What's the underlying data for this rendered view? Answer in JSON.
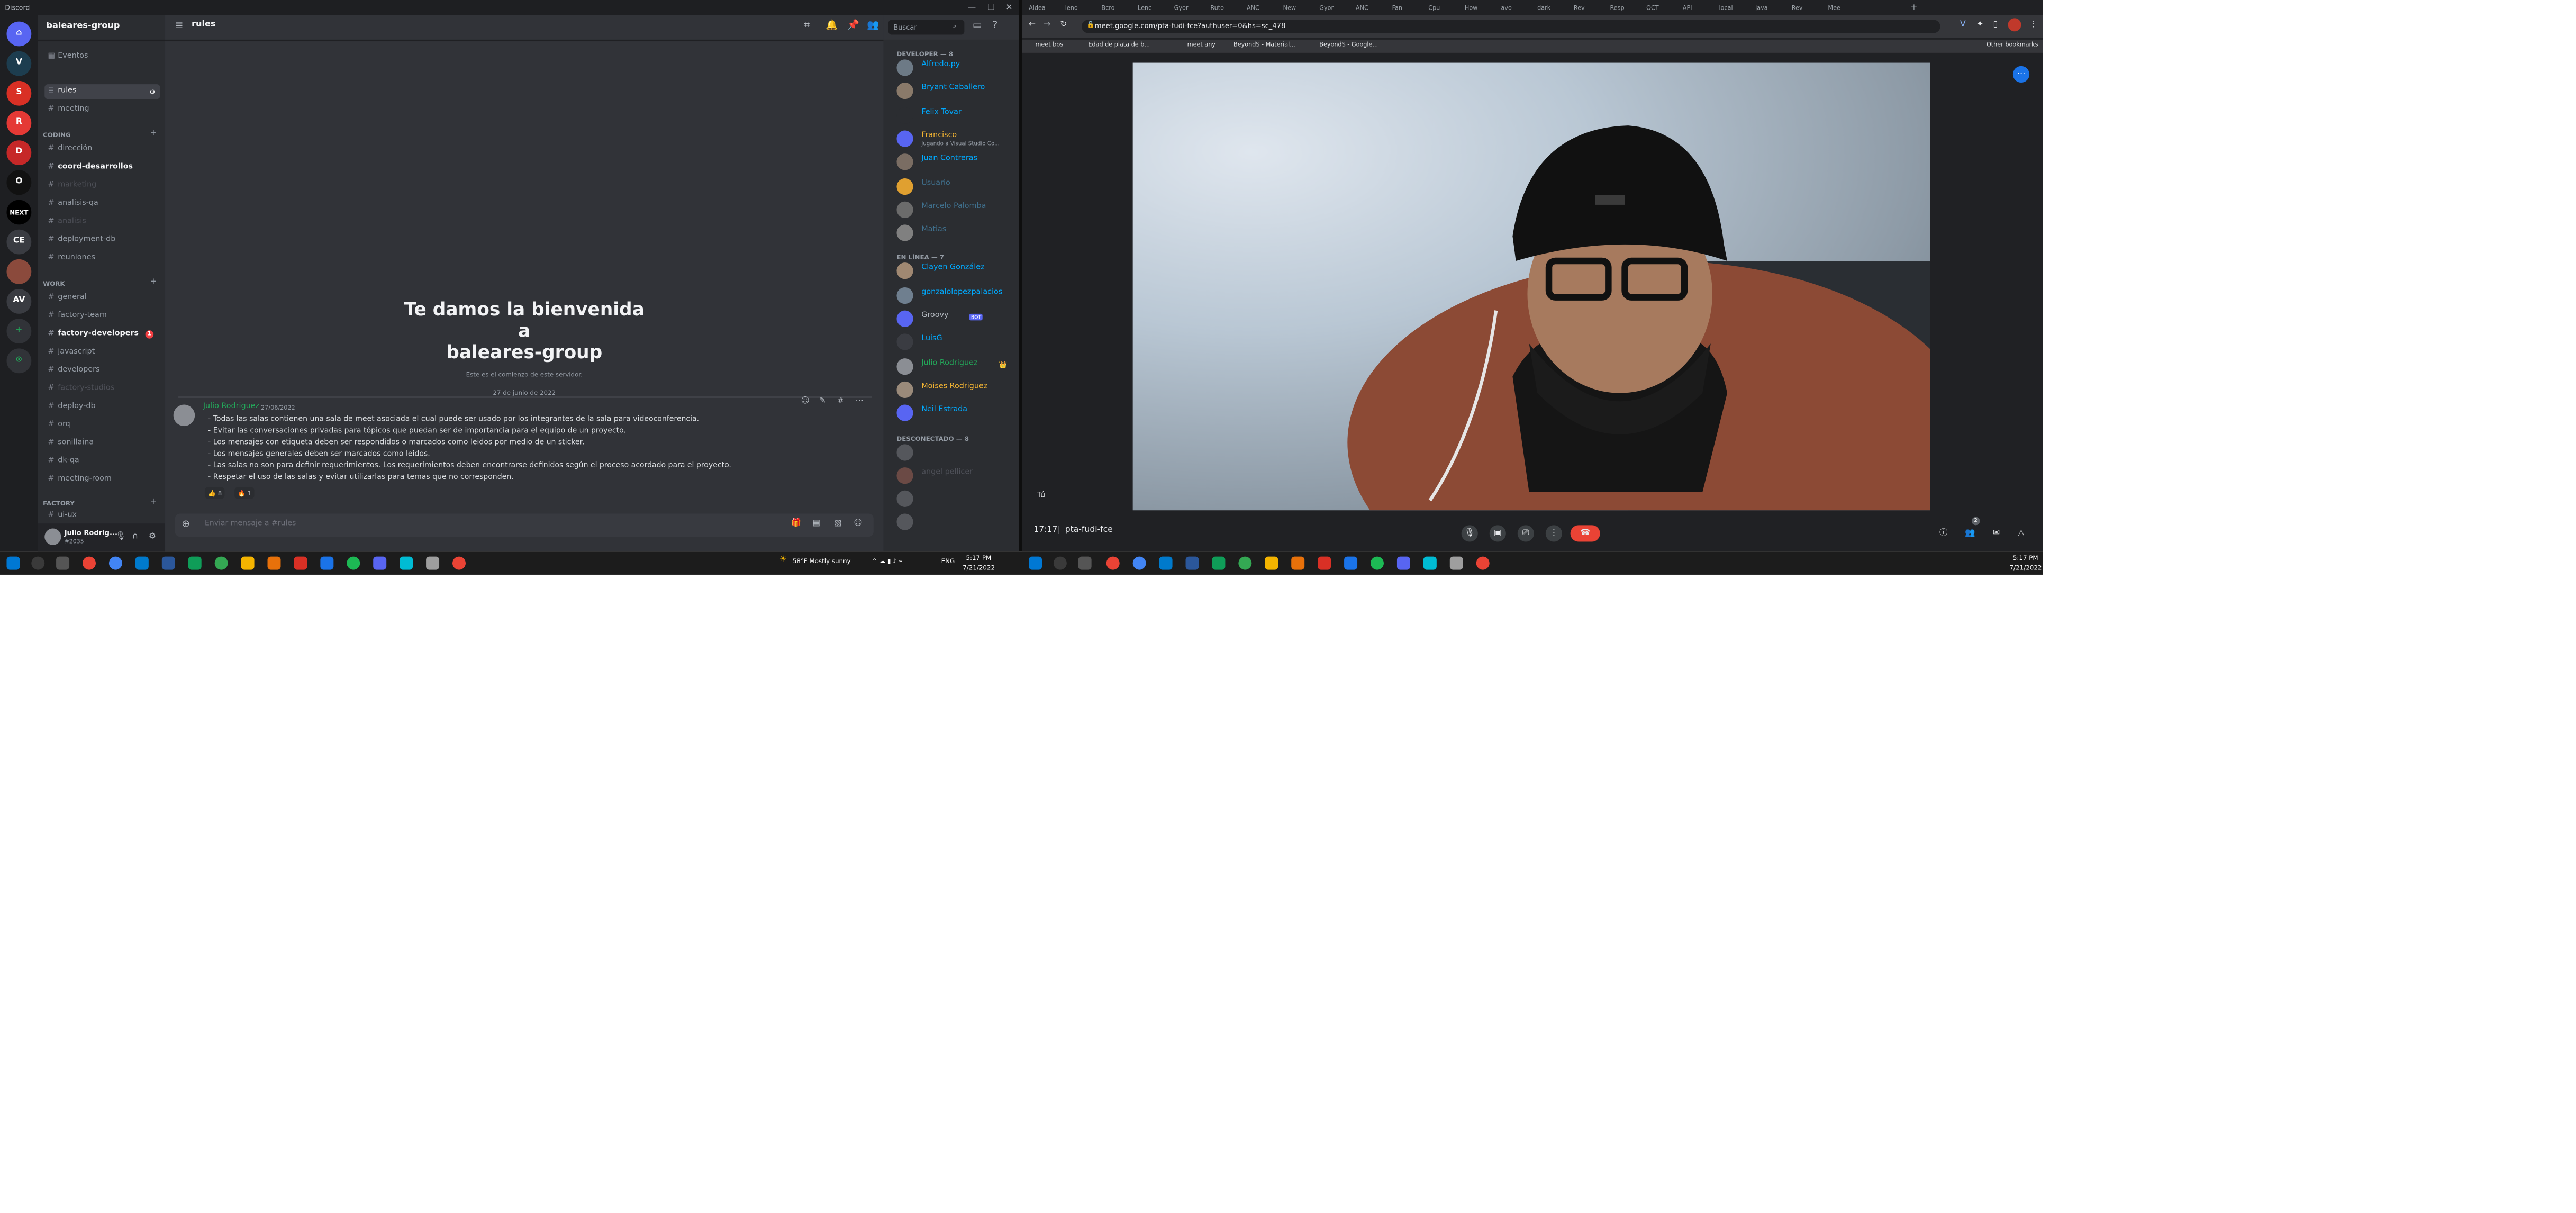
{
  "discord": {
    "window_title": "Discord",
    "server_name": "baleares-group",
    "events_label": "Eventos",
    "guilds": [
      "V",
      "S",
      "R",
      "D",
      "O",
      "NEXT",
      "CE",
      "AV",
      "+",
      "⊙"
    ],
    "top_channels": [
      "rules",
      "meeting"
    ],
    "categories": {
      "coding": {
        "label": "CODING",
        "channels": [
          "dirección",
          "coord-desarrollos",
          "marketing",
          "analisis-qa",
          "analisis",
          "deployment-db",
          "reuniones"
        ]
      },
      "work": {
        "label": "WORK",
        "channels": [
          "general",
          "factory-team",
          "factory-developers",
          "javascript",
          "developers",
          "factory-studios",
          "deploy-db",
          "orq",
          "sonillaina",
          "dk-qa",
          "meeting-room"
        ]
      },
      "factory": {
        "label": "FACTORY",
        "channels": [
          "ui-ux"
        ]
      }
    },
    "badge_count": "1",
    "user": {
      "name": "Julio Rodrig...",
      "tag": "#2035"
    },
    "channel_header": "rules",
    "search_placeholder": "Buscar",
    "welcome_line1": "Te damos la bienvenida",
    "welcome_line2": "a",
    "welcome_line3": "baleares-group",
    "welcome_sub": "Este es el comienzo de este servidor.",
    "date_divider": "27 de junio de 2022",
    "message": {
      "author": "Julio Rodriguez",
      "date": "27/06/2022",
      "lines": [
        "- Todas las salas contienen una sala de meet asociada el cual puede ser usado por los integrantes de la sala para videoconferencia.",
        "- Evitar las conversaciones privadas para tópicos que puedan ser de importancia para el equipo de un proyecto.",
        "- Los mensajes con etiqueta deben ser respondidos o marcados como leidos por medio de un sticker.",
        "- Los mensajes generales deben ser marcados como leidos.",
        "- Las salas no son para definir requerimientos. Los requerimientos deben encontrarse definidos según el proceso acordado para el proyecto.",
        "- Respetar el uso de las salas y evitar utilizarlas para temas que no corresponden."
      ],
      "reactions": [
        {
          "emoji": "👍",
          "count": "8"
        },
        {
          "emoji": "🔥",
          "count": "1"
        }
      ]
    },
    "composer_placeholder": "Enviar mensaje a #rules",
    "members": {
      "developer_label": "DEVELOPER — 8",
      "developers": [
        {
          "name": "Alfredo.py",
          "color": "#00a8fc",
          "avatar": "#6d7a86"
        },
        {
          "name": "Bryant Caballero",
          "color": "#00a8fc",
          "avatar": "#8a7a6a"
        },
        {
          "name": "Felix Tovar",
          "color": "#00a8fc",
          "avatar": "#2b2d31"
        },
        {
          "name": "Francisco",
          "color": "#f0b232",
          "avatar": "#5865f2",
          "status": "Jugando a Visual Studio Co..."
        },
        {
          "name": "Juan Contreras",
          "color": "#00a8fc",
          "avatar": "#7a6d63"
        },
        {
          "name": "Usuario",
          "color": "#3f6f8c",
          "avatar": "#e0a030"
        },
        {
          "name": "Marcelo Palomba",
          "color": "#3f6f8c",
          "avatar": "#6b6b6b"
        },
        {
          "name": "Matias",
          "color": "#3f6f8c",
          "avatar": "#808080"
        }
      ],
      "online_label": "EN LÍNEA — 7",
      "online": [
        {
          "name": "Clayen González",
          "color": "#00a8fc",
          "avatar": "#a08872"
        },
        {
          "name": "gonzalolopezpalacios",
          "color": "#00a8fc",
          "avatar": "#6f7f8f"
        },
        {
          "name": "Groovy",
          "color": "#b5bac1",
          "avatar": "#5865f2",
          "bot": "BOT"
        },
        {
          "name": "LuisG",
          "color": "#00a8fc",
          "avatar": "#3a3c42"
        },
        {
          "name": "Julio Rodriguez",
          "color": "#23a559",
          "avatar": "#8b8e94",
          "crown": "👑"
        },
        {
          "name": "Moises Rodriguez",
          "color": "#f0b232",
          "avatar": "#9a8a7a"
        },
        {
          "name": "Neil Estrada",
          "color": "#00a8fc",
          "avatar": "#5865f2"
        }
      ],
      "offline_label": "DESCONECTADO — 8",
      "offline": [
        {
          "name": "",
          "color": "#4e5058",
          "avatar": "#55575c"
        },
        {
          "name": "angel pellicer",
          "color": "#4e5058",
          "avatar": "#6b4a45"
        },
        {
          "name": "",
          "color": "#4e5058",
          "avatar": "#55575c"
        },
        {
          "name": "",
          "color": "#4e5058",
          "avatar": "#55575c"
        }
      ]
    }
  },
  "chrome": {
    "tabs": [
      "Aldea",
      "leno",
      "Bcro",
      "Lenc",
      "Gyor",
      "Ruto",
      "ANC",
      "New",
      "Gyor",
      "ANC",
      "Fan",
      "Cpu",
      "How",
      "avo",
      "dark",
      "Rev",
      "Resp",
      "OCT",
      "API",
      "local",
      "java",
      "Rev",
      "Mee"
    ],
    "url": "meet.google.com/pta-fudi-fce?authuser=0&hs=sc_478",
    "bookmarks": [
      "meet bos",
      "Edad de plata de b...",
      "meet any",
      "BeyondS - Material...",
      "BeyondS - Google..."
    ],
    "other_bookmarks": "Other bookmarks"
  },
  "meet": {
    "self_label": "Tú",
    "time": "17:17",
    "separator": "|",
    "code": "pta-fudi-fce",
    "participants_badge": "2"
  },
  "taskbar": {
    "weather": "58°F  Mostly sunny",
    "lang": "ENG",
    "time": "5:17 PM",
    "date": "7/21/2022"
  }
}
